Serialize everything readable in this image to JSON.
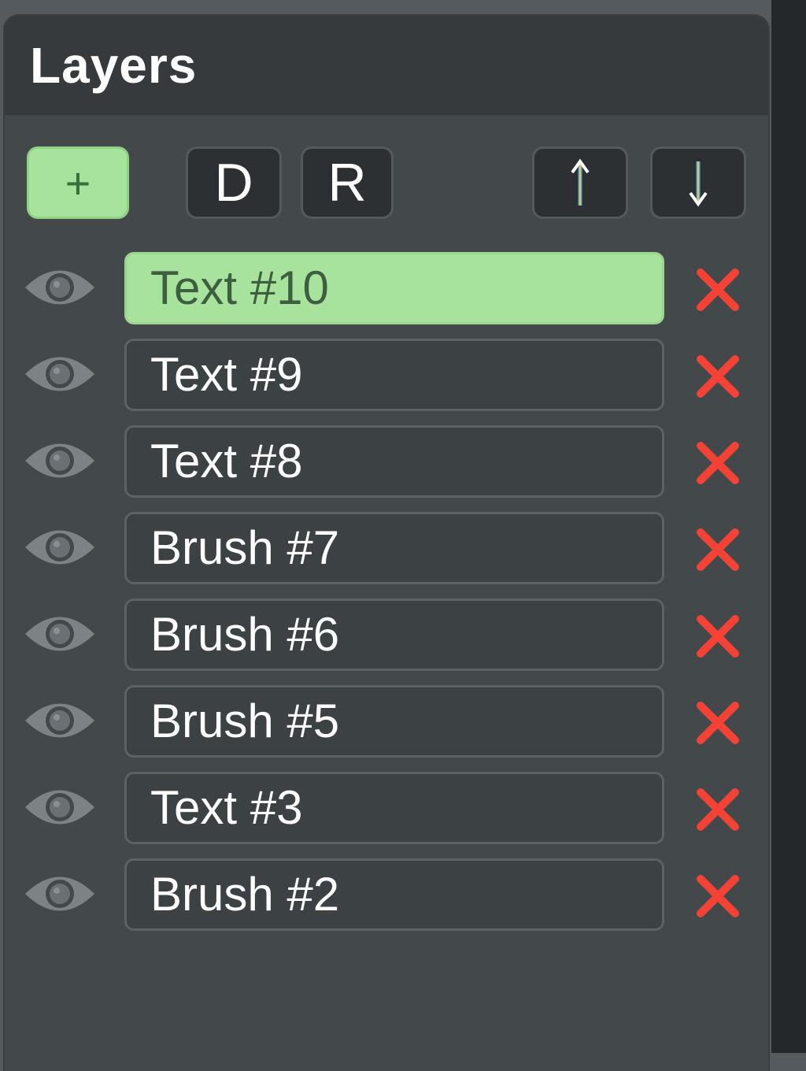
{
  "panel": {
    "title": "Layers"
  },
  "toolbar": {
    "add_label": "+",
    "duplicate_label": "D",
    "rename_label": "R",
    "move_up_icon": "arrow-up-icon",
    "move_down_icon": "arrow-down-icon"
  },
  "layers": [
    {
      "name": "Text #10",
      "selected": true
    },
    {
      "name": "Text #9",
      "selected": false
    },
    {
      "name": "Text #8",
      "selected": false
    },
    {
      "name": "Brush #7",
      "selected": false
    },
    {
      "name": "Brush #6",
      "selected": false
    },
    {
      "name": "Brush #5",
      "selected": false
    },
    {
      "name": "Text #3",
      "selected": false
    },
    {
      "name": "Brush #2",
      "selected": false
    }
  ],
  "icons": {
    "visibility": "eye-icon",
    "delete": "close-icon"
  },
  "colors": {
    "selected_layer": "#a7e39c",
    "delete_icon": "#f44336",
    "arrow_icon": "#5aa9d8"
  }
}
